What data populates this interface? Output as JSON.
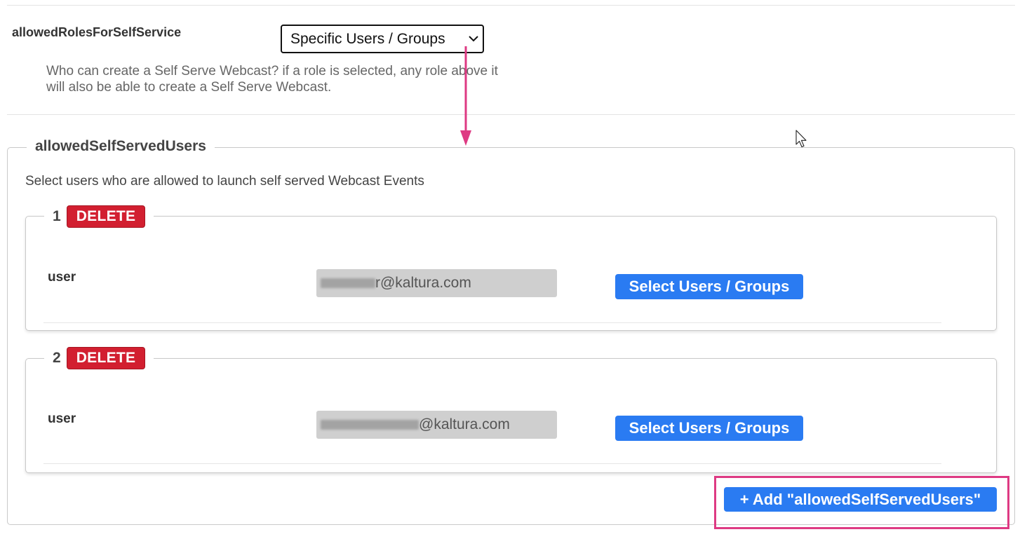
{
  "role_field": {
    "label": "allowedRolesForSelfService",
    "selected_value": "Specific Users / Groups",
    "help_text": "Who can create a Self Serve Webcast? if a role is selected, any role above it will also be able to create a Self Serve Webcast."
  },
  "users_section": {
    "legend": "allowedSelfServedUsers",
    "description": "Select users who are allowed to launch self served Webcast Events",
    "items": [
      {
        "number": "1",
        "delete_label": "DELETE",
        "field_label": "user",
        "value_visible": "r@kaltura.com",
        "select_label": "Select Users / Groups"
      },
      {
        "number": "2",
        "delete_label": "DELETE",
        "field_label": "user",
        "value_visible": "@kaltura.com",
        "select_label": "Select Users / Groups"
      }
    ],
    "add_label": "+ Add \"allowedSelfServedUsers\""
  },
  "colors": {
    "primary_button": "#2a7bf2",
    "delete_button": "#d21f30",
    "annotation": "#de3a83"
  },
  "icons": {
    "select_chevron": "chevron-down-icon",
    "cursor": "mouse-pointer-icon",
    "annotation_arrow": "arrow-down-icon"
  }
}
